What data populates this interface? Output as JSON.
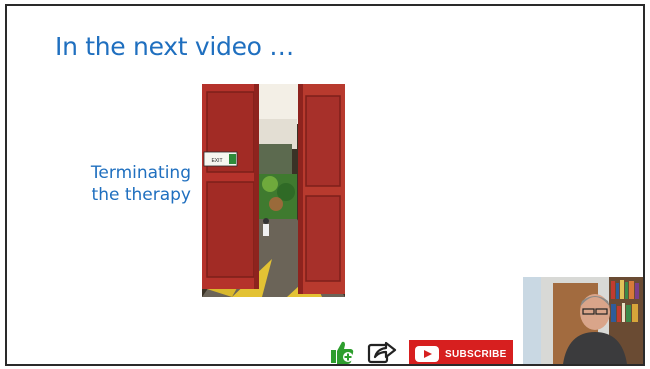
{
  "slide": {
    "title": "In the next video …",
    "subtitle_line1": "Terminating",
    "subtitle_line2": "the therapy",
    "door_sign": "EXIT"
  },
  "actions": {
    "like_icon": "thumbs-up-icon",
    "share_icon": "share-icon",
    "subscribe_label": "SUBSCRIBE"
  },
  "colors": {
    "accent": "#1f6fbf",
    "door_red": "#b5322b",
    "subscribe_red": "#d71f1f",
    "like_green": "#2e9e2e"
  }
}
